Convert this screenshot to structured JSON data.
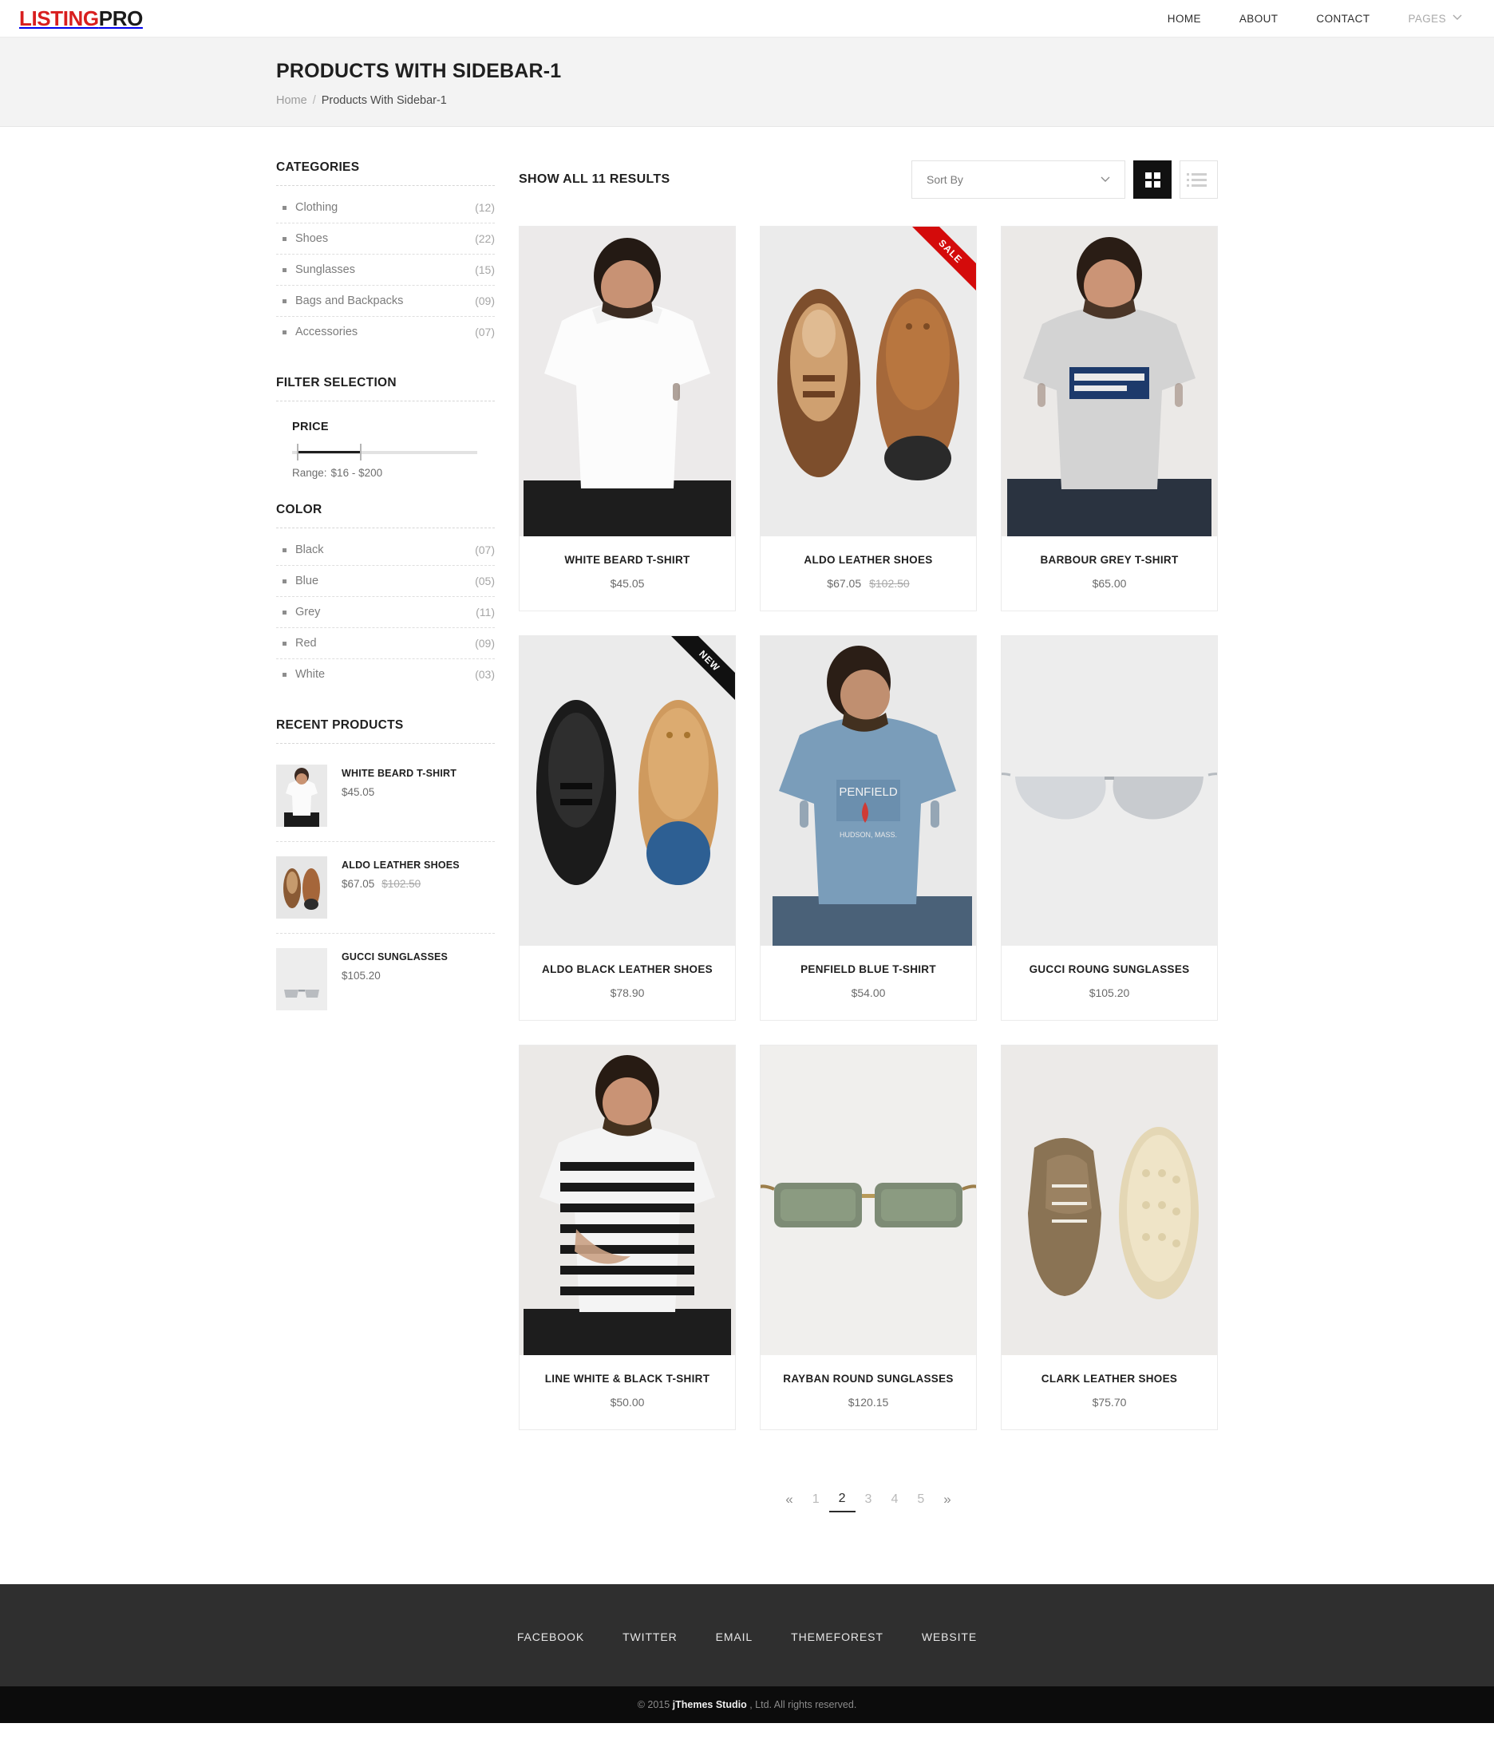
{
  "header": {
    "logo_primary": "LISTING",
    "logo_secondary": "PRO",
    "nav": [
      {
        "label": "HOME",
        "muted": false
      },
      {
        "label": "ABOUT",
        "muted": false
      },
      {
        "label": "CONTACT",
        "muted": false
      },
      {
        "label": "PAGES",
        "muted": true
      }
    ],
    "caret_icon": "⌄"
  },
  "page_head": {
    "title": "PRODUCTS WITH SIDEBAR-1",
    "breadcrumb_home": "Home",
    "breadcrumb_sep": "/",
    "breadcrumb_current": "Products With Sidebar-1"
  },
  "sidebar": {
    "categories_title": "CATEGORIES",
    "categories": [
      {
        "label": "Clothing",
        "count": "(12)"
      },
      {
        "label": "Shoes",
        "count": "(22)"
      },
      {
        "label": "Sunglasses",
        "count": "(15)"
      },
      {
        "label": "Bags and Backpacks",
        "count": "(09)"
      },
      {
        "label": "Accessories",
        "count": "(07)"
      }
    ],
    "filter_title": "FILTER SELECTION",
    "price_title": "PRICE",
    "price_range_label": "Range:",
    "price_range_value": "$16 - $200",
    "price_min": 16,
    "price_max": 200,
    "color_title": "COLOR",
    "colors": [
      {
        "label": "Black",
        "count": "(07)"
      },
      {
        "label": "Blue",
        "count": "(05)"
      },
      {
        "label": "Grey",
        "count": "(11)"
      },
      {
        "label": "Red",
        "count": "(09)"
      },
      {
        "label": "White",
        "count": "(03)"
      }
    ],
    "recent_title": "RECENT PRODUCTS",
    "recent": [
      {
        "name": "WHITE BEARD T-SHIRT",
        "price": "$45.05",
        "old_price": "",
        "thumb": "white-tshirt"
      },
      {
        "name": "ALDO LEATHER SHOES",
        "price": "$67.05",
        "old_price": "$102.50",
        "thumb": "brown-shoes"
      },
      {
        "name": "GUCCI SUNGLASSES",
        "price": "$105.20",
        "old_price": "",
        "thumb": "sunglasses"
      }
    ]
  },
  "toolbar": {
    "results_label": "SHOW ALL 11 RESULTS",
    "sort_value": "Sort By",
    "sort_caret": "⌄",
    "grid_view_label": "grid-view",
    "list_view_label": "list-view",
    "active_view": "grid"
  },
  "products": [
    {
      "name": "WHITE BEARD T-SHIRT",
      "price": "$45.05",
      "old_price": "",
      "badge": "",
      "art": "white-tshirt-model"
    },
    {
      "name": "ALDO LEATHER SHOES",
      "price": "$67.05",
      "old_price": "$102.50",
      "badge": "SALE",
      "art": "brown-shoes-pair"
    },
    {
      "name": "BARBOUR GREY T-SHIRT",
      "price": "$65.00",
      "old_price": "",
      "badge": "",
      "art": "grey-tshirt-model"
    },
    {
      "name": "ALDO BLACK LEATHER SHOES",
      "price": "$78.90",
      "old_price": "",
      "badge": "NEW",
      "art": "black-shoes-pair"
    },
    {
      "name": "PENFIELD BLUE T-SHIRT",
      "price": "$54.00",
      "old_price": "",
      "badge": "",
      "art": "blue-tshirt-model"
    },
    {
      "name": "GUCCI ROUNG SUNGLASSES",
      "price": "$105.20",
      "old_price": "",
      "badge": "",
      "art": "aviator-sunglasses"
    },
    {
      "name": "LINE WHITE & BLACK T-SHIRT",
      "price": "$50.00",
      "old_price": "",
      "badge": "",
      "art": "striped-tshirt-model"
    },
    {
      "name": "RAYBAN ROUND SUNGLASSES",
      "price": "$120.15",
      "old_price": "",
      "badge": "",
      "art": "green-sunglasses"
    },
    {
      "name": "CLARK LEATHER SHOES",
      "price": "$75.70",
      "old_price": "",
      "badge": "",
      "art": "desert-boots"
    }
  ],
  "pagination": {
    "prev": "«",
    "next": "»",
    "pages": [
      "1",
      "2",
      "3",
      "4",
      "5"
    ],
    "active": "2"
  },
  "footer": {
    "links": [
      "FACEBOOK",
      "TWITTER",
      "EMAIL",
      "THEMEFOREST",
      "WEBSITE"
    ],
    "copyright_prefix": "© 2015 ",
    "copyright_brand": "jThemes Studio",
    "copyright_suffix": " , Ltd. All rights reserved."
  },
  "colors": {
    "brand_red": "#d81f1f",
    "sale_red": "#d40b0b",
    "new_black": "#111111",
    "footer_bg": "#2f2f2f",
    "copyright_bg": "#0c0c0c"
  }
}
